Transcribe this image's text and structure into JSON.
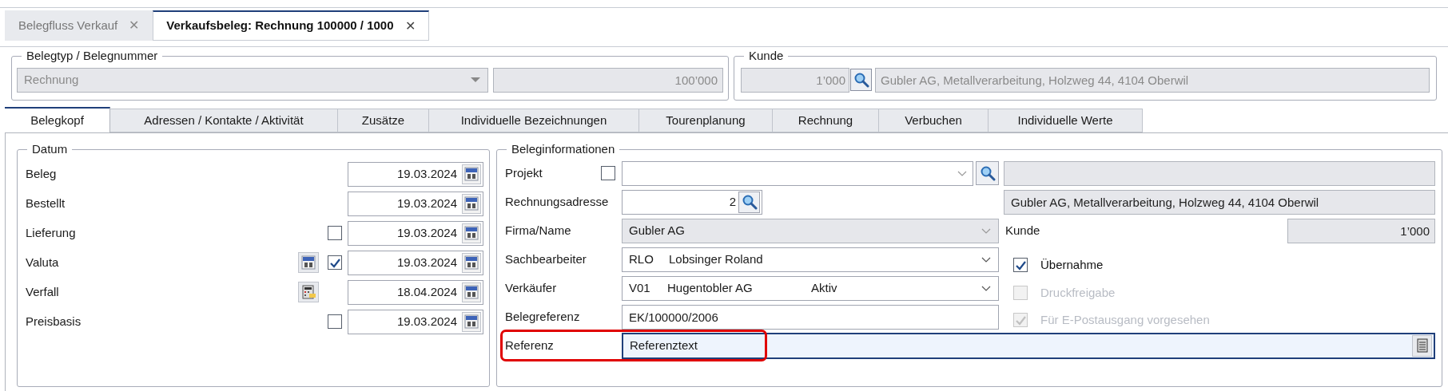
{
  "document_tabs": [
    {
      "label": "Belegfluss Verkauf",
      "close": "✕",
      "selected": false
    },
    {
      "label": "Verkaufsbeleg: Rechnung 100000 / 1000",
      "close": "✕",
      "selected": true
    }
  ],
  "belegtyp_group": {
    "title": "Belegtyp / Belegnummer",
    "type_value": "Rechnung",
    "number_value": "100’000",
    "disabled": true
  },
  "kunde_group": {
    "title": "Kunde",
    "number_value": "1’000",
    "name_value": "Gubler AG, Metallverarbeitung, Holzweg 44, 4104 Oberwil",
    "disabled": true
  },
  "form_tabs": [
    {
      "label": "Belegkopf",
      "selected": true
    },
    {
      "label": "Adressen / Kontakte / Aktivität",
      "selected": false
    },
    {
      "label": "Zusätze",
      "selected": false
    },
    {
      "label": "Individuelle Bezeichnungen",
      "selected": false
    },
    {
      "label": "Tourenplanung",
      "selected": false
    },
    {
      "label": "Rechnung",
      "selected": false
    },
    {
      "label": "Verbuchen",
      "selected": false
    },
    {
      "label": "Individuelle Werte",
      "selected": false
    }
  ],
  "datum_group": {
    "title": "Datum",
    "rows": [
      {
        "kind": "plain",
        "label": "Beleg",
        "value": "19.03.2024"
      },
      {
        "kind": "plain",
        "label": "Bestellt",
        "value": "19.03.2024"
      },
      {
        "kind": "checkbox",
        "label": "Lieferung",
        "checked": false,
        "value": "19.03.2024"
      },
      {
        "kind": "calendar_checkbox",
        "label": "Valuta",
        "checked": true,
        "value": "19.03.2024"
      },
      {
        "kind": "calculator",
        "label": "Verfall",
        "value": "18.04.2024"
      },
      {
        "kind": "checkbox",
        "label": "Preisbasis",
        "checked": false,
        "value": "19.03.2024"
      }
    ]
  },
  "beleginfo_group": {
    "title": "Beleginformationen",
    "projekt": {
      "label": "Projekt",
      "checked": false
    },
    "rechnungsadresse": {
      "label": "Rechnungsadresse",
      "value": "2",
      "address": "Gubler AG, Metallverarbeitung, Holzweg 44, 4104 Oberwil"
    },
    "firma": {
      "label": "Firma/Name",
      "value": "Gubler AG",
      "disabled": true
    },
    "kunde": {
      "label": "Kunde",
      "value": "1’000"
    },
    "sachbearbeiter": {
      "label": "Sachbearbeiter",
      "code": "RLO",
      "name": "Lobsinger Roland"
    },
    "verkaeufer": {
      "label": "Verkäufer",
      "code": "V01",
      "name": "Hugentobler AG",
      "status": "Aktiv"
    },
    "belegreferenz": {
      "label": "Belegreferenz",
      "value": "EK/100000/2006"
    },
    "referenz": {
      "label": "Referenz",
      "value": "Referenztext",
      "focused": true,
      "highlighted": true
    },
    "options": [
      {
        "label": "Übernahme",
        "checked": true,
        "disabled": false
      },
      {
        "label": "Druckfreigabe",
        "checked": false,
        "disabled": true
      },
      {
        "label": "Für E-Postausgang vorgesehen",
        "checked": true,
        "disabled": true
      }
    ]
  }
}
